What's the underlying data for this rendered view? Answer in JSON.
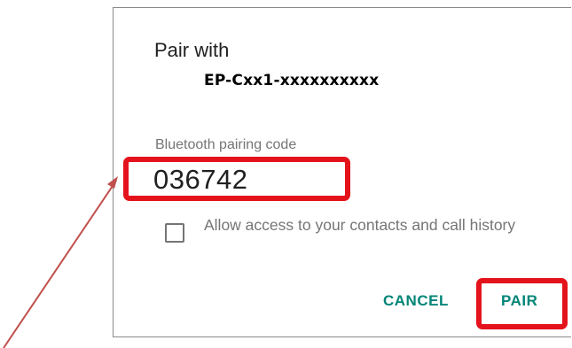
{
  "dialog": {
    "title": "Pair with",
    "device_name": "EP-Cxx1-xxxxxxxxxx",
    "code_label": "Bluetooth pairing code",
    "code_value": "036742",
    "checkbox_label": "Allow access to your contacts and call history",
    "checkbox_checked": false,
    "cancel_label": "CANCEL",
    "pair_label": "PAIR"
  },
  "annotations": {
    "highlight_color": "#e4131b",
    "arrow_color": "#c0504d",
    "highlighted": [
      "pairing-code",
      "pair-button"
    ]
  },
  "colors": {
    "accent": "#008577",
    "secondary_text": "#757575",
    "primary_text": "#212121"
  }
}
